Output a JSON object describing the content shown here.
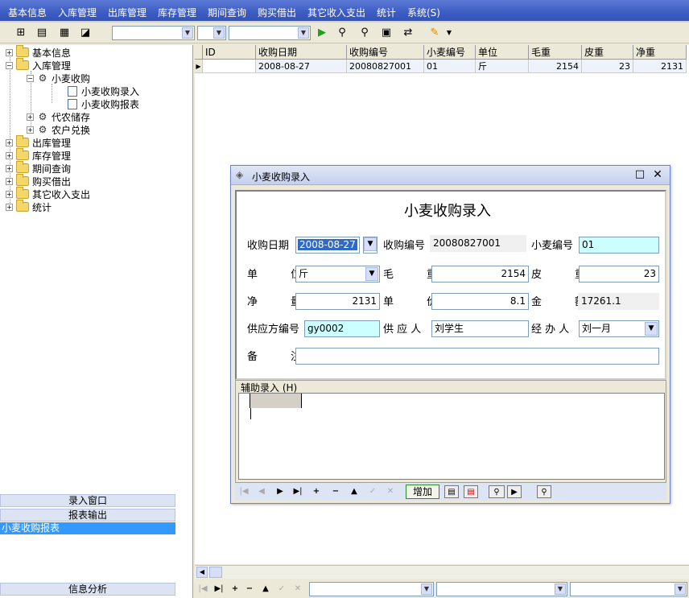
{
  "menu": [
    "基本信息",
    "入库管理",
    "出库管理",
    "库存管理",
    "期间查询",
    "购买借出",
    "其它收入支出",
    "统计",
    "系统(S)"
  ],
  "tree": {
    "items": [
      {
        "label": "基本信息",
        "type": "folder",
        "exp": "+"
      },
      {
        "label": "入库管理",
        "type": "folder",
        "exp": "-"
      },
      {
        "label": "小麦收购",
        "type": "gear",
        "exp": "-"
      },
      {
        "label": "小麦收购录入",
        "type": "doc"
      },
      {
        "label": "小麦收购报表",
        "type": "doc"
      },
      {
        "label": "代农储存",
        "type": "gear",
        "exp": "+"
      },
      {
        "label": "农户兑换",
        "type": "gear",
        "exp": "+"
      },
      {
        "label": "出库管理",
        "type": "folder",
        "exp": "+"
      },
      {
        "label": "库存管理",
        "type": "folder",
        "exp": "+"
      },
      {
        "label": "期间查询",
        "type": "folder",
        "exp": "+"
      },
      {
        "label": "购买借出",
        "type": "folder",
        "exp": "+"
      },
      {
        "label": "其它收入支出",
        "type": "folder",
        "exp": "+"
      },
      {
        "label": "统计",
        "type": "folder",
        "exp": "+"
      }
    ]
  },
  "panels": {
    "entry": "录入窗口",
    "report": "报表输出",
    "selected": "小麦收购报表",
    "analysis": "信息分析"
  },
  "grid": {
    "headers": [
      "ID",
      "收购日期",
      "收购编号",
      "小麦编号",
      "单位",
      "毛重",
      "皮重",
      "净重"
    ],
    "row": [
      "",
      "2008-08-27",
      "20080827001",
      "01",
      "斤",
      "2154",
      "23",
      "2131"
    ]
  },
  "dialog": {
    "title": "小麦收购录入",
    "heading": "小麦收购录入",
    "labels": {
      "date": "收购日期",
      "code": "收购编号",
      "wheat_no": "小麦编号",
      "unit": "单　位",
      "gross": "毛　重",
      "tare": "皮　重",
      "net": "净　量",
      "price": "单　价",
      "amount": "金　额",
      "supplier_no": "供应方编号",
      "supplier": "供 应 人",
      "handler": "经 办 人",
      "remark": "备　注"
    },
    "values": {
      "date": "2008-08-27",
      "code": "20080827001",
      "wheat_no": "01",
      "unit": "斤",
      "gross": "2154",
      "tare": "23",
      "net": "2131",
      "price": "8.1",
      "amount": "17261.1",
      "supplier_no": "gy0002",
      "supplier": "刘学生",
      "handler": "刘一月",
      "remark": ""
    },
    "aux_label": "辅助录入 (H)",
    "add_button": "增加"
  }
}
